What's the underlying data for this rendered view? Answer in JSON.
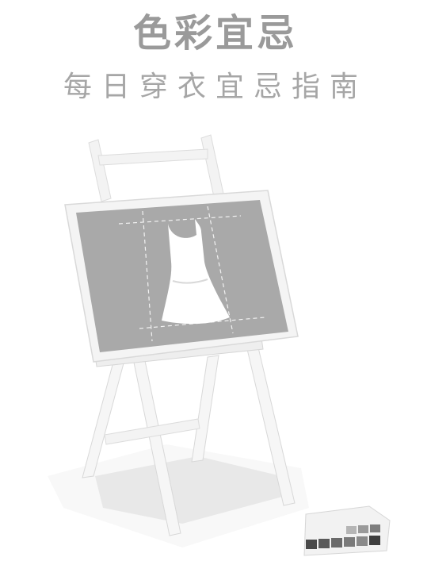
{
  "header": {
    "title": "色彩宜忌",
    "subtitle": "每日穿衣宜忌指南"
  },
  "illustration": {
    "icon": "easel-dress-icon",
    "palette_icon": "color-swatch-icon",
    "colors": {
      "board": "#a9a9a9",
      "frame": "#f4f4f4",
      "frame_edge": "#dcdcdc",
      "floor": "#ededed",
      "shadow": "#e3e3e3",
      "swatch_dark": "#4a4a4a",
      "swatch_light": "#9a9a9a"
    }
  }
}
